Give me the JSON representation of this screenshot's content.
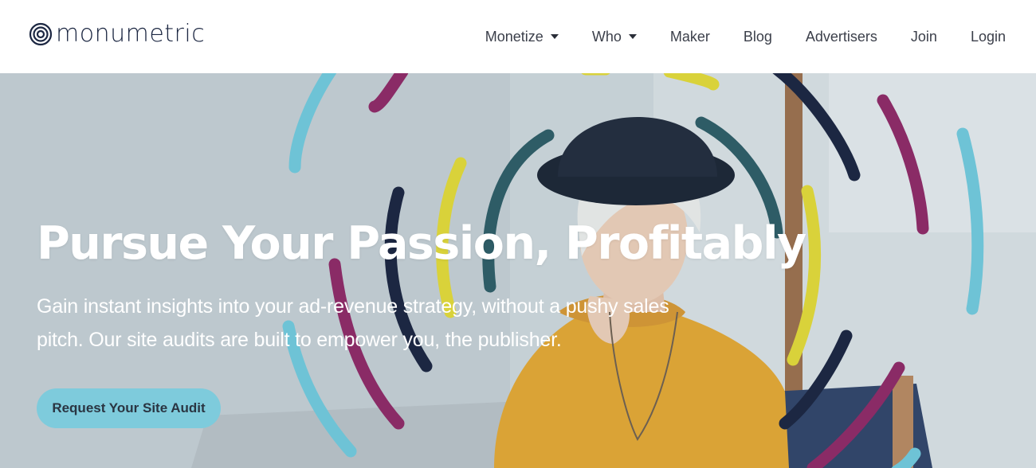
{
  "brand": {
    "name": "monumetric"
  },
  "nav": {
    "items": [
      {
        "label": "Monetize",
        "dropdown": true
      },
      {
        "label": "Who",
        "dropdown": true
      },
      {
        "label": "Maker",
        "dropdown": false
      },
      {
        "label": "Blog",
        "dropdown": false
      },
      {
        "label": "Advertisers",
        "dropdown": false
      },
      {
        "label": "Join",
        "dropdown": false
      },
      {
        "label": "Login",
        "dropdown": false
      }
    ]
  },
  "hero": {
    "title": "Pursue Your Passion, Profitably",
    "subtitle": "Gain instant insights into your ad-revenue strategy, without a pushy sales pitch. Our site audits are built to empower you, the publisher.",
    "cta_label": "Request Your Site Audit"
  },
  "colors": {
    "teal": "#6ec3d6",
    "magenta": "#8a2b66",
    "yellow": "#d9d23a",
    "navy": "#1c2742",
    "dark_teal": "#2e5c66",
    "cta_bg": "#7ecbdc",
    "sweater": "#e6a52a"
  }
}
